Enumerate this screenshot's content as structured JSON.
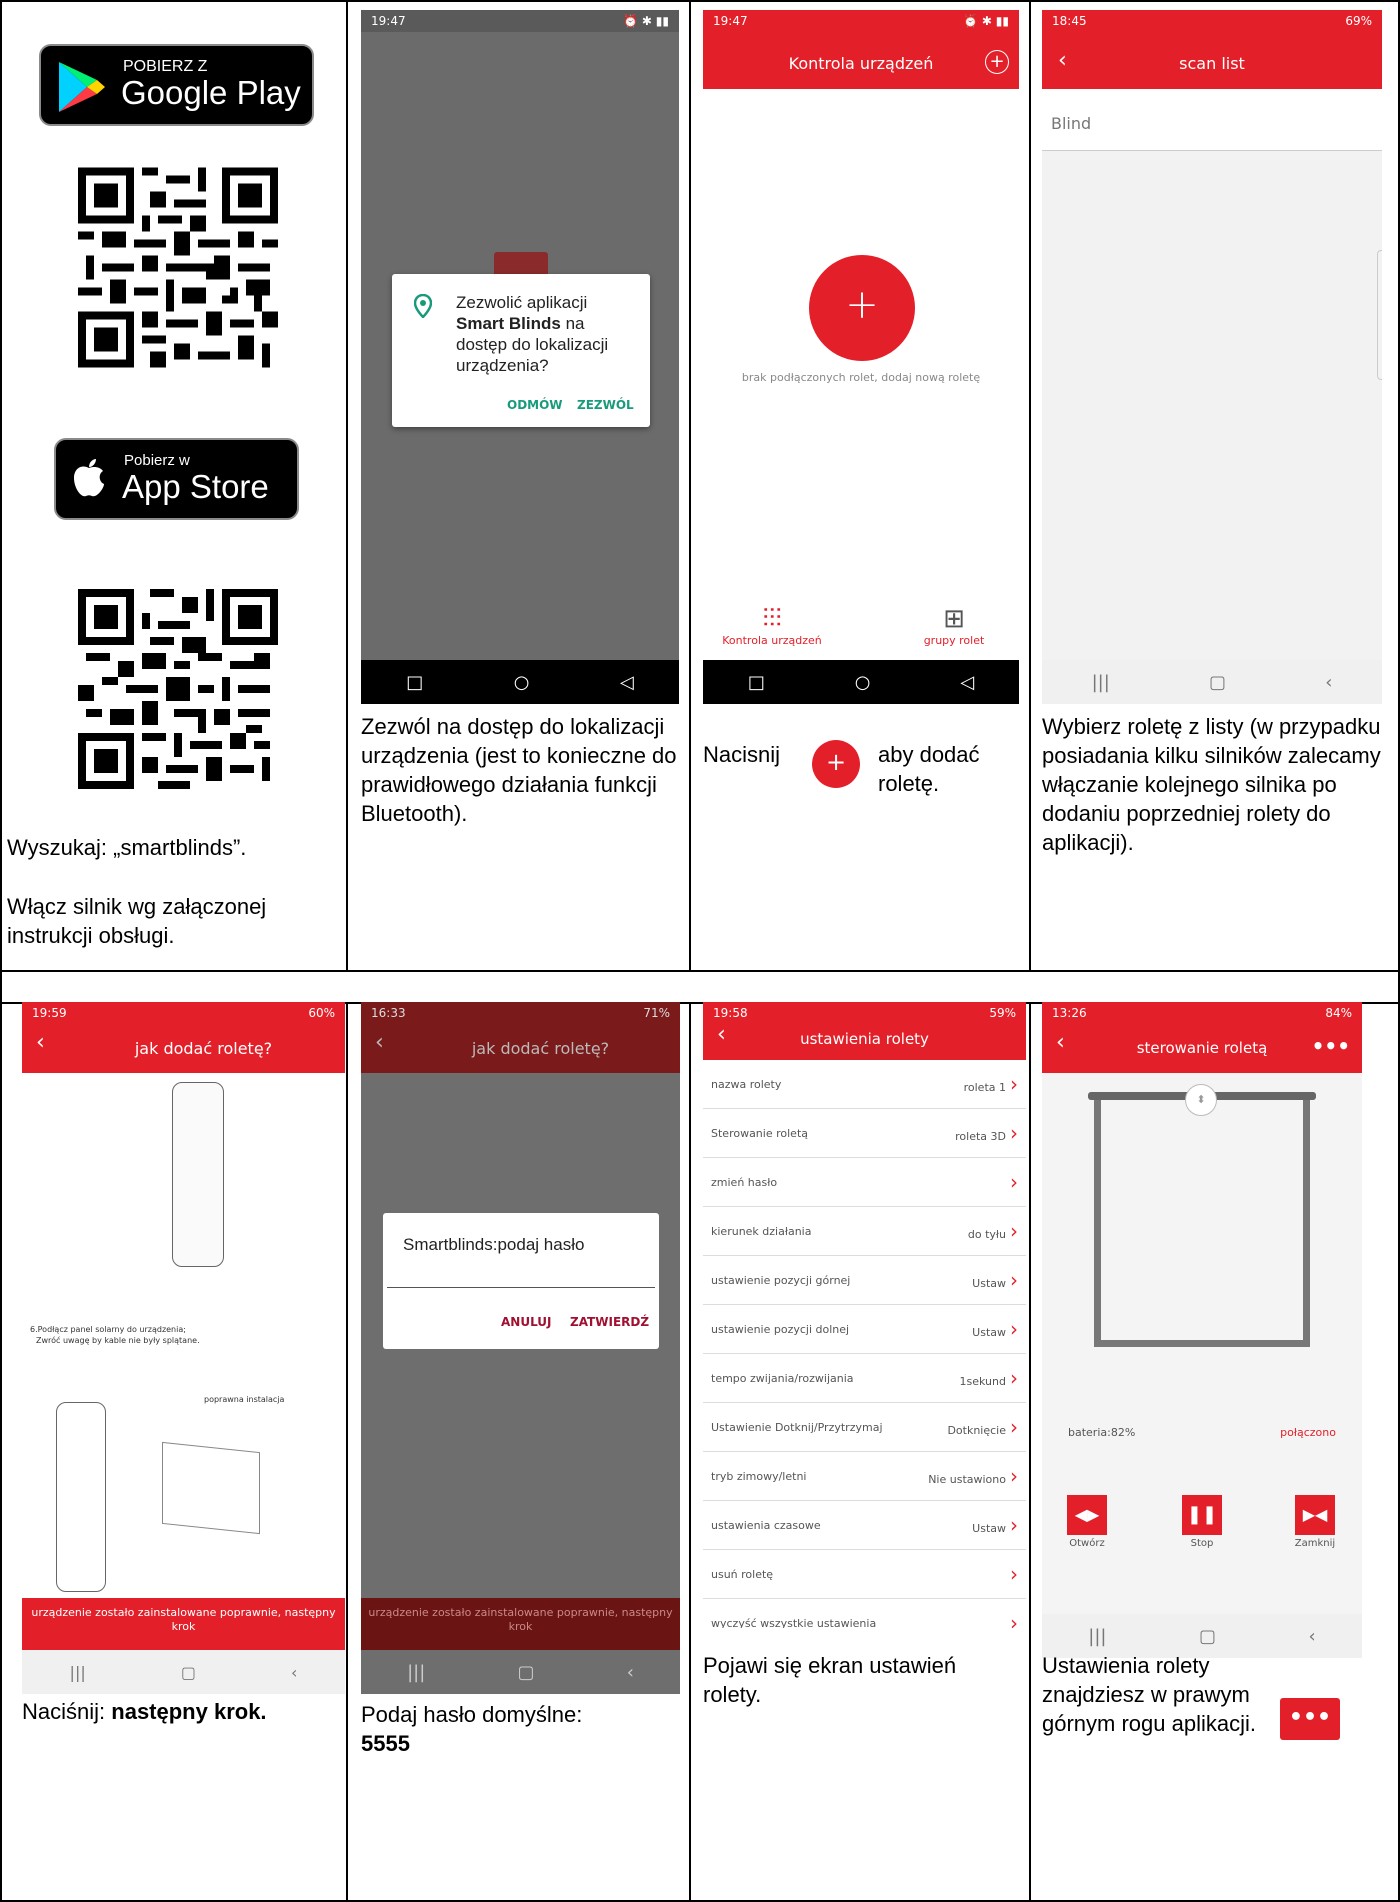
{
  "store": {
    "google_small": "POBIERZ Z",
    "google_big": "Google Play",
    "apple_small": "Pobierz w",
    "apple_big": "App Store"
  },
  "captions": {
    "c1a": "Wyszukaj: „smartblinds”.",
    "c1b": "Włącz silnik wg załączonej instrukcji obsługi.",
    "c2": "Zezwól na dostęp do lokalizacji urządzenia (jest to konieczne do prawidłowego działania funkcji Bluetooth).",
    "c3a": "Nacisnij",
    "c3b": "aby dodać roletę.",
    "c4": "Wybierz roletę z listy (w przypadku posiadania kilku silników zalecamy włączanie kolejnego silnika po dodaniu poprzedniej rolety do aplikacji).",
    "c5a": "Naciśnij:",
    "c5b": "następny krok.",
    "c6a": "Podaj hasło domyślne:",
    "c6b": "5555",
    "c7": "Pojawi się ekran ustawień rolety.",
    "c8": "Ustawienia rolety znajdziesz w prawym górnym rogu aplikacji."
  },
  "s2": {
    "time": "19:47",
    "dialog_l1": "Zezwolić aplikacji",
    "dialog_bold": "Smart Blinds",
    "dialog_l2": "na dostęp do lokalizacji urządzenia?",
    "deny": "ODMÓW",
    "allow": "ZEZWÓL"
  },
  "s3": {
    "time": "19:47",
    "title": "Kontrola urządzeń",
    "empty": "brak podłączonych rolet, dodaj nową roletę",
    "tab1": "Kontrola urządzeń",
    "tab2": "grupy rolet"
  },
  "s4": {
    "time": "18:45",
    "battery": "69%",
    "title": "scan list",
    "item": "Blind"
  },
  "s5": {
    "time": "19:59",
    "battery": "60%",
    "title": "jak dodać roletę?",
    "instr1": "6.Podłącz panel solarny do urządzenia;",
    "instr2": "Zwróć uwagę by kable nie były splątane.",
    "correct": "poprawna instalacja",
    "next": "urządzenie zostało zainstalowane poprawnie, następny krok"
  },
  "s6": {
    "time": "16:33",
    "battery": "71%",
    "title": "jak dodać roletę?",
    "dialog_title": "Smartblinds:podaj hasło",
    "cancel": "ANULUJ",
    "confirm": "ZATWIERDŹ",
    "next": "urządzenie zostało zainstalowane poprawnie, następny krok"
  },
  "s7": {
    "time": "19:58",
    "battery": "59%",
    "title": "ustawienia rolety",
    "rows": [
      {
        "label": "nazwa rolety",
        "value": "roleta 1"
      },
      {
        "label": "Sterowanie roletą",
        "value": "roleta 3D"
      },
      {
        "label": "zmień hasło",
        "value": ""
      },
      {
        "label": "kierunek działania",
        "value": "do tyłu"
      },
      {
        "label": "ustawienie pozycji górnej",
        "value": "Ustaw"
      },
      {
        "label": "ustawienie pozycji dolnej",
        "value": "Ustaw"
      },
      {
        "label": "tempo zwijania/rozwijania",
        "value": "1sekund"
      },
      {
        "label": "Ustawienie Dotknij/Przytrzymaj",
        "value": "Dotknięcie"
      },
      {
        "label": "tryb zimowy/letni",
        "value": "Nie ustawiono"
      },
      {
        "label": "ustawienia czasowe",
        "value": "Ustaw"
      },
      {
        "label": "usuń roletę",
        "value": ""
      },
      {
        "label": "wyczyść wszystkie ustawienia",
        "value": ""
      }
    ]
  },
  "s8": {
    "time": "13:26",
    "battery": "84%",
    "title": "sterowanie roletą",
    "battery_label": "bateria:82%",
    "status": "połączono",
    "open": "Otwórz",
    "stop": "Stop",
    "close": "Zamknij"
  },
  "colors": {
    "accent": "#e3202a"
  }
}
